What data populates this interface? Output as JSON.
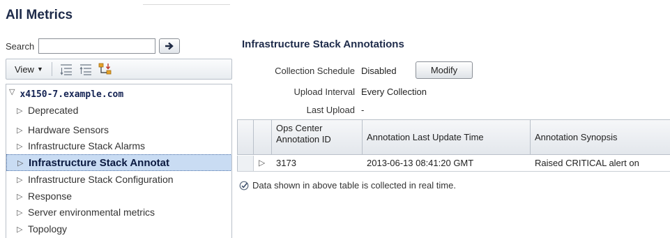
{
  "page": {
    "title": "All Metrics"
  },
  "left_panel": {
    "search": {
      "label": "Search",
      "value": "",
      "go_icon": "arrow-right-icon"
    },
    "toolbar": {
      "view_label": "View",
      "icons": [
        "expand-all-icon",
        "collapse-all-icon",
        "hierarchy-icon"
      ]
    },
    "tree": {
      "root": "x4150-7.example.com",
      "items": [
        {
          "label": "Deprecated",
          "selected": false
        },
        {
          "label": "Hardware Sensors",
          "selected": false
        },
        {
          "label": "Infrastructure Stack Alarms",
          "selected": false
        },
        {
          "label": "Infrastructure Stack Annotat",
          "selected": true
        },
        {
          "label": "Infrastructure Stack Configuration",
          "selected": false
        },
        {
          "label": "Response",
          "selected": false
        },
        {
          "label": "Server environmental metrics",
          "selected": false
        },
        {
          "label": "Topology",
          "selected": false
        }
      ]
    }
  },
  "main": {
    "title": "Infrastructure Stack Annotations",
    "properties": [
      {
        "label": "Collection Schedule",
        "value": "Disabled"
      },
      {
        "label": "Upload Interval",
        "value": "Every Collection"
      },
      {
        "label": "Last Upload",
        "value": "-"
      }
    ],
    "modify_label": "Modify",
    "table": {
      "columns": [
        "Ops Center Annotation ID",
        "Annotation Last Update Time",
        "Annotation Synopsis"
      ],
      "rows": [
        [
          "3173",
          "2013-06-13 08:41:20 GMT",
          "Raised CRITICAL alert on"
        ]
      ]
    },
    "note": "Data shown in above table is collected in real time."
  },
  "colors": {
    "title": "#1e2b4a",
    "selection": "#c9dcf3",
    "border": "#b9c0c9"
  }
}
